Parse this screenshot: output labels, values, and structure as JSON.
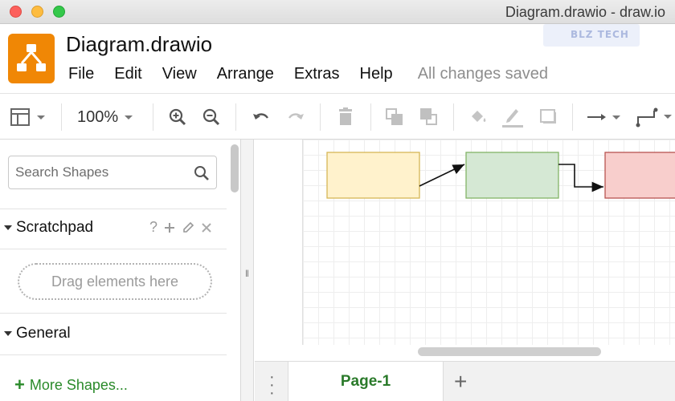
{
  "window": {
    "title": "Diagram.drawio - draw.io"
  },
  "watermark": {
    "text": "BLZ TECH"
  },
  "header": {
    "document_title": "Diagram.drawio",
    "menu": [
      "File",
      "Edit",
      "View",
      "Arrange",
      "Extras",
      "Help"
    ],
    "save_status": "All changes saved"
  },
  "toolbar": {
    "zoom": "100%",
    "icons": [
      "panel-layout-icon",
      "zoom-in-icon",
      "zoom-out-icon",
      "undo-icon",
      "redo-icon",
      "delete-icon",
      "to-front-icon",
      "to-back-icon",
      "fill-color-icon",
      "line-color-icon",
      "shadow-icon",
      "connection-arrow-icon",
      "waypoints-icon"
    ]
  },
  "sidebar": {
    "search_placeholder": "Search Shapes",
    "scratchpad_label": "Scratchpad",
    "scratchpad_help": "?",
    "dropzone_text": "Drag elements here",
    "general_label": "General",
    "more_shapes_label": "More Shapes..."
  },
  "diagram": {
    "shapes": [
      {
        "name": "yellow-box",
        "fill": "#fff2cc",
        "stroke": "#d6b656"
      },
      {
        "name": "green-box",
        "fill": "#d5e8d4",
        "stroke": "#82b366"
      },
      {
        "name": "red-box",
        "fill": "#f8cecc",
        "stroke": "#b85450"
      }
    ]
  },
  "pages": {
    "active_tab": "Page-1",
    "add_label": "+"
  },
  "colors": {
    "brand": "#f08705",
    "accent_green": "#2a7a2a"
  }
}
